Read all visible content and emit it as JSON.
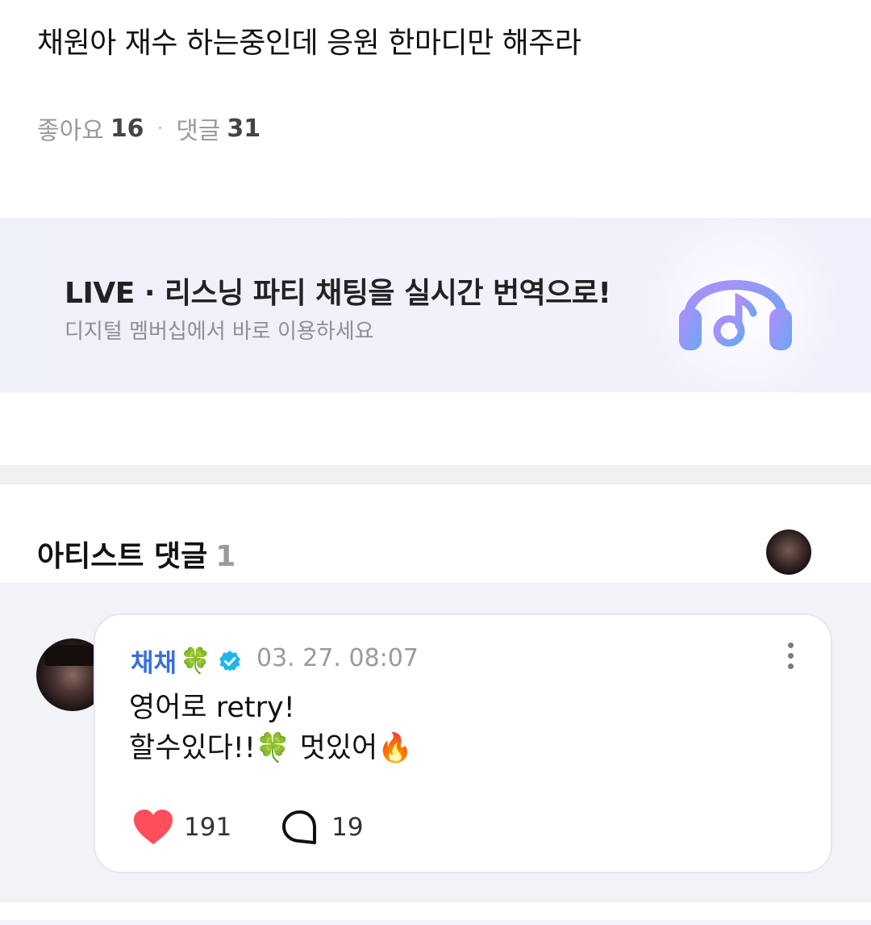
{
  "post": {
    "title": "채원아 재수 하는중인데 응원 한마디만 해주라",
    "likes_label": "좋아요",
    "likes_count": "16",
    "separator": "·",
    "comments_label": "댓글",
    "comments_count": "31"
  },
  "banner": {
    "title": "LIVE · 리스닝 파티 채팅을 실시간 번역으로!",
    "subtitle": "디지털 멤버십에서 바로 이용하세요",
    "icon": "headphones-music-note-icon",
    "colors": {
      "background": "#eef0fa",
      "icon_start": "#a88cf7",
      "icon_end": "#6ea8f5"
    }
  },
  "artist_comments": {
    "heading": "아티스트 댓글",
    "count": "1"
  },
  "comment": {
    "author": "채채",
    "author_emoji": "🍀",
    "verified_icon": "verified-badge-icon",
    "date": "03. 27. 08:07",
    "line1": "영어로  retry!",
    "line2_a": "할수있다!!",
    "line2_clover": "🍀",
    "line2_b": " 멋있어",
    "line2_fire": "🔥",
    "likes": "191",
    "replies": "19",
    "colors": {
      "author": "#3a6fd8",
      "verified": "#1fb6e8",
      "heart": "#ff4d5a"
    }
  }
}
